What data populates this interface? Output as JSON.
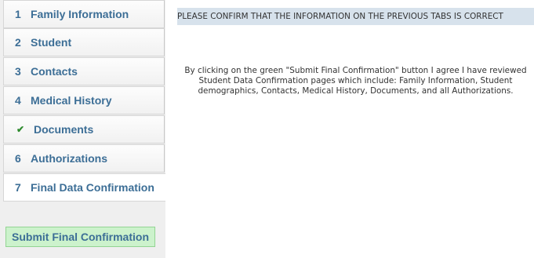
{
  "tabs": [
    {
      "number": "1",
      "label": "Family Information",
      "status": "numbered"
    },
    {
      "number": "2",
      "label": "Student",
      "status": "numbered"
    },
    {
      "number": "3",
      "label": "Contacts",
      "status": "numbered"
    },
    {
      "number": "4",
      "label": "Medical History",
      "status": "numbered"
    },
    {
      "number": "",
      "label": "Documents",
      "status": "complete",
      "icon": "check-icon"
    },
    {
      "number": "6",
      "label": "Authorizations",
      "status": "numbered"
    },
    {
      "number": "7",
      "label": "Final Data Confirmation",
      "status": "active"
    }
  ],
  "submit_button": {
    "label": "Submit Final Confirmation"
  },
  "main": {
    "banner": "PLEASE CONFIRM THAT THE INFORMATION ON THE PREVIOUS TABS IS CORRECT",
    "message": "By clicking on the green \"Submit Final Confirmation\" button I agree I have reviewed Student Data Confirmation pages which include:  Family Information, Student demographics, Contacts, Medical History, Documents, and all Authorizations."
  },
  "colors": {
    "tab_text": "#3c6e96",
    "check": "#2e8b2e",
    "submit_bg": "#ccf2cc",
    "banner_bg": "#d7e2ec"
  }
}
